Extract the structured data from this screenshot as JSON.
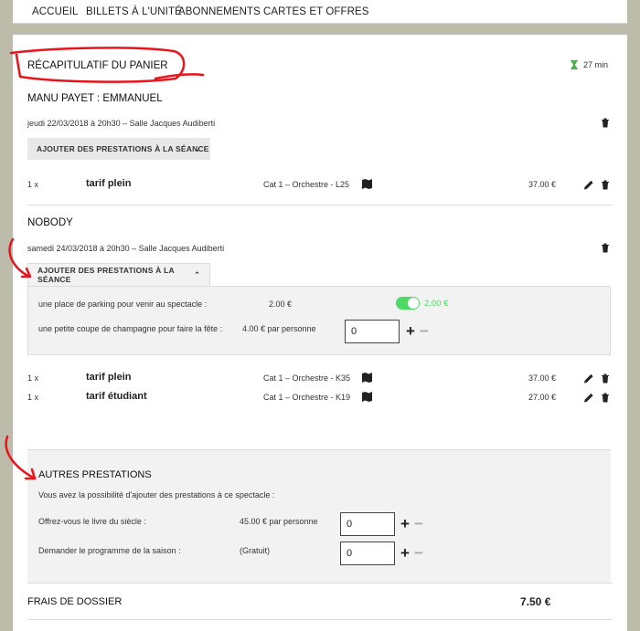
{
  "nav": [
    "ACCUEIL",
    "BILLETS À L'UNITÉ",
    "ABONNEMENTS",
    "CARTES ET OFFRES"
  ],
  "cart": {
    "title": "RÉCAPITULATIF DU PANIER",
    "timer": "27 min",
    "add_services_label": "AJOUTER DES PRESTATIONS À LA SÉANCE",
    "sections": [
      {
        "name": "MANU PAYET : EMMANUEL",
        "date": "jeudi 22/03/2018 à 20h30 – Salle Jacques Audiberti",
        "tickets": [
          {
            "qty": "1 x",
            "tariff": "tarif plein",
            "seat": "Cat 1 – Orchestre - L25",
            "price": "37.00 €"
          }
        ]
      },
      {
        "name": "NOBODY",
        "date": "samedi 24/03/2018 à 20h30 – Salle Jacques Audiberti",
        "services": [
          {
            "label": "une place de parking pour venir au spectacle :",
            "price": "2.00 €",
            "toggle_label": "2.00 €"
          },
          {
            "label": "une petite coupe de champagne pour faire la fête :",
            "price": "4.00 € par personne",
            "qty": "0"
          }
        ],
        "tickets": [
          {
            "qty": "1 x",
            "tariff": "tarif plein",
            "seat": "Cat 1 – Orchestre - K35",
            "price": "37.00 €"
          },
          {
            "qty": "1 x",
            "tariff": "tarif étudiant",
            "seat": "Cat 1 – Orchestre - K19",
            "price": "27.00 €"
          }
        ]
      }
    ],
    "other": {
      "title": "AUTRES PRESTATIONS",
      "intro": "Vous avez la possibilité d'ajouter des prestations à ce spectacle :",
      "items": [
        {
          "label": "Offrez-vous le livre du siècle :",
          "price": "45.00 € par personne",
          "qty": "0"
        },
        {
          "label": "Demander le programme de la saison :",
          "price": "(Gratuit)",
          "qty": "0"
        }
      ]
    },
    "fees": {
      "label": "FRAIS DE DOSSIER",
      "amount": "7.50 €"
    }
  },
  "colors": {
    "annotation": "#e8141c",
    "toggle": "#4cd964",
    "panel_bg": "#f2f2f2",
    "page_bg": "#bdbcaa"
  }
}
